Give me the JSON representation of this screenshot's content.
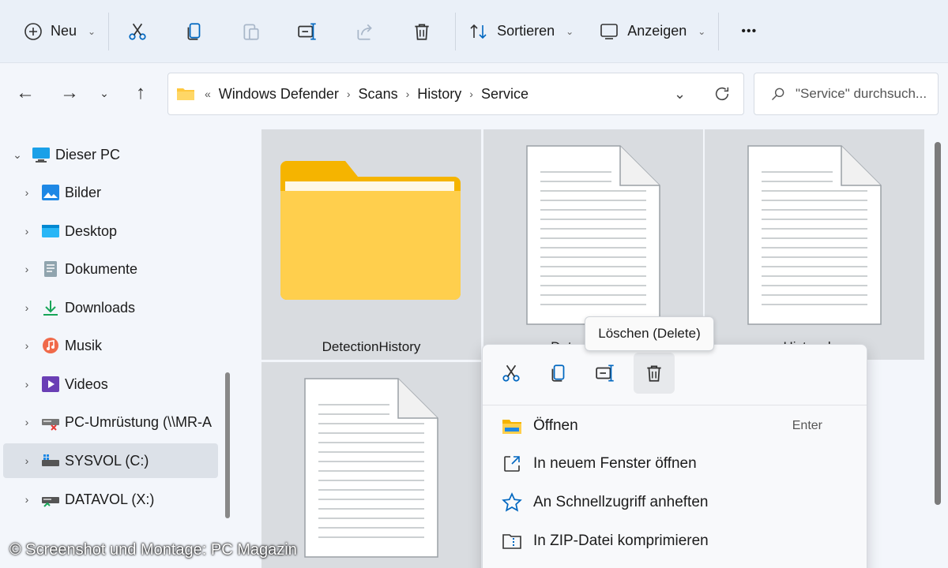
{
  "toolbar": {
    "new_label": "Neu",
    "sort_label": "Sortieren",
    "view_label": "Anzeigen",
    "more_label": "•••"
  },
  "address": {
    "overflow": "«",
    "crumbs": [
      "Windows Defender",
      "Scans",
      "History",
      "Service"
    ],
    "search_placeholder": "\"Service\" durchsuch..."
  },
  "sidebar": {
    "root": "Dieser PC",
    "items": [
      {
        "label": "Bilder",
        "icon": "pictures-icon"
      },
      {
        "label": "Desktop",
        "icon": "desktop-icon"
      },
      {
        "label": "Dokumente",
        "icon": "documents-icon"
      },
      {
        "label": "Downloads",
        "icon": "downloads-icon"
      },
      {
        "label": "Musik",
        "icon": "music-icon"
      },
      {
        "label": "Videos",
        "icon": "videos-icon"
      },
      {
        "label": "PC-Umrüstung (\\\\MR-A",
        "icon": "network-drive-icon"
      },
      {
        "label": "SYSVOL (C:)",
        "icon": "drive-icon"
      },
      {
        "label": "DATAVOL (X:)",
        "icon": "drive-icon"
      }
    ],
    "selected": "SYSVOL (C:)"
  },
  "files": [
    {
      "name": "DetectionHistory",
      "type": "folder"
    },
    {
      "name": "Detections.log",
      "type": "file"
    },
    {
      "name": "History.log",
      "type": "file"
    },
    {
      "name": "",
      "type": "file"
    }
  ],
  "tooltip": "Löschen (Delete)",
  "context_menu": {
    "items": [
      {
        "label": "Öffnen",
        "shortcut": "Enter"
      },
      {
        "label": "In neuem Fenster öffnen",
        "shortcut": ""
      },
      {
        "label": "An Schnellzugriff anheften",
        "shortcut": ""
      },
      {
        "label": "In ZIP-Datei komprimieren",
        "shortcut": ""
      }
    ]
  },
  "watermark": "© Screenshot und Montage: PC Magazin",
  "colors": {
    "accent": "#0067c0",
    "folder": "#ffc83d",
    "tile_selected": "#d9dce0"
  }
}
